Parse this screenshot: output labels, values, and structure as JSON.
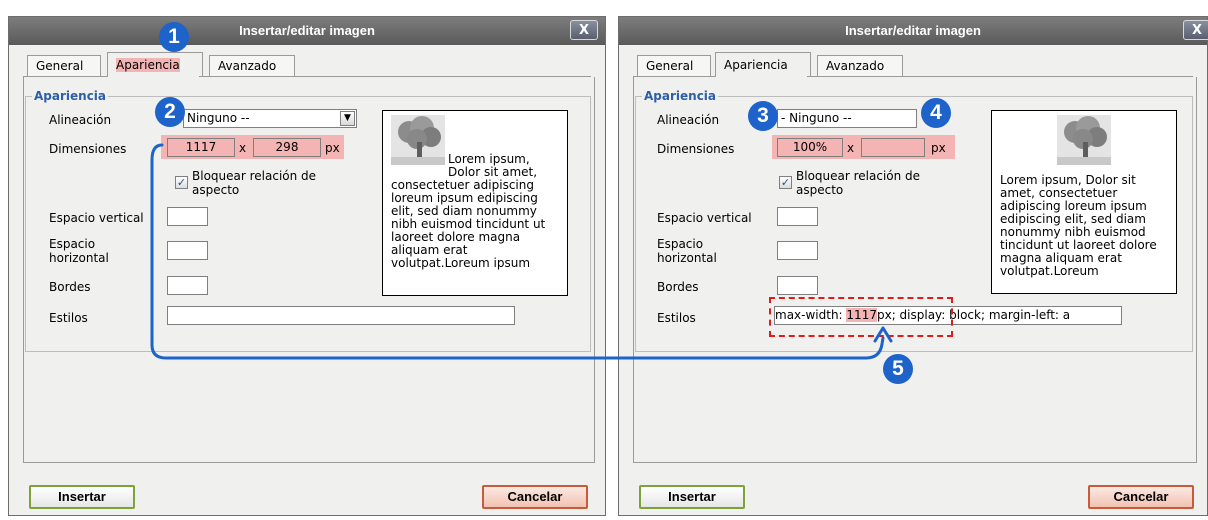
{
  "dialog_left": {
    "title": "Insertar/editar imagen",
    "close": "X",
    "tabs": [
      "General",
      "Apariencia",
      "Avanzado"
    ],
    "legend": "Apariencia",
    "labels": {
      "alignment": "Alineación",
      "dimensions": "Dimensiones",
      "lock": "Bloquear relación de aspecto",
      "vspace": "Espacio vertical",
      "hspace": "Espacio horizontal",
      "borders": "Bordes",
      "styles": "Estilos"
    },
    "alignment_value": "Ninguno --",
    "width": "1117",
    "times": "x",
    "height": "298",
    "unit": "px",
    "preview_text": "Lorem ipsum, Dolor sit amet, consectetuer adipiscing loreum ipsum edipiscing elit, sed diam nonummy nibh euismod tincidunt ut laoreet dolore magna aliquam erat volutpat.Loreum ipsum",
    "styles_value": "",
    "insert": "Insertar",
    "cancel": "Cancelar"
  },
  "dialog_right": {
    "title": "Insertar/editar imagen",
    "close": "X",
    "tabs": [
      "General",
      "Apariencia",
      "Avanzado"
    ],
    "legend": "Apariencia",
    "labels": {
      "alignment": "Alineación",
      "dimensions": "Dimensiones",
      "lock": "Bloquear relación de aspecto",
      "vspace": "Espacio vertical",
      "hspace": "Espacio horizontal",
      "borders": "Bordes",
      "styles": "Estilos"
    },
    "alignment_value": "- Ninguno --",
    "width": "100%",
    "times": "x",
    "height": "",
    "unit": "px",
    "preview_text": "Lorem ipsum, Dolor sit amet, consectetuer adipiscing loreum ipsum edipiscing elit, sed diam nonummy nibh euismod tincidunt ut laoreet dolore magna aliquam erat volutpat.Loreum",
    "styles_prefix": "max-width: ",
    "styles_highlight": "1117",
    "styles_suffix": "px; display: block; margin-left: a",
    "insert": "Insertar",
    "cancel": "Cancelar"
  },
  "badges": [
    "1",
    "2",
    "3",
    "4",
    "5"
  ],
  "colors": {
    "badge": "#1d63c9",
    "highlight": "#f5b4b4",
    "dashed_box": "#e11a1a",
    "legend": "#2d5ea8"
  }
}
